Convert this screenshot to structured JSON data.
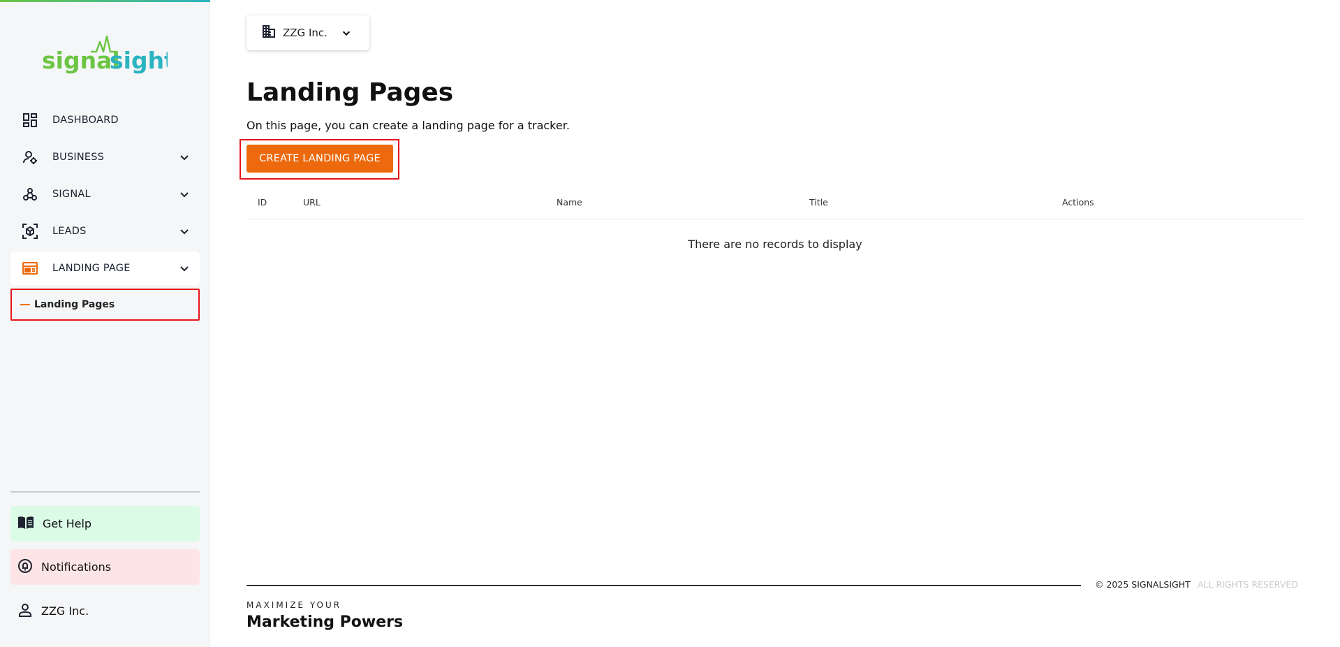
{
  "brand": {
    "logo_text_part1": "signal",
    "logo_text_part2": "sight",
    "colors": {
      "green": "#6cc644",
      "teal": "#2bb3c0",
      "accent_orange": "#ec6a0d",
      "highlight_red": "#e4161b"
    }
  },
  "sidebar": {
    "items": [
      {
        "label": "DASHBOARD",
        "icon": "dashboard-icon"
      },
      {
        "label": "BUSINESS",
        "icon": "business-user-icon"
      },
      {
        "label": "SIGNAL",
        "icon": "webhook-icon"
      },
      {
        "label": "LEADS",
        "icon": "leads-cube-icon"
      },
      {
        "label": "LANDING PAGE",
        "icon": "landing-page-icon"
      }
    ],
    "sub_items": [
      {
        "label": "Landing Pages"
      }
    ],
    "bottom": {
      "get_help": "Get Help",
      "notifications": "Notifications",
      "account": "ZZG Inc."
    }
  },
  "main": {
    "org_select": {
      "value": "ZZG Inc."
    },
    "title": "Landing Pages",
    "description": "On this page, you can create a landing page for a tracker.",
    "create_button": "CREATE LANDING PAGE",
    "table": {
      "columns": [
        "ID",
        "URL",
        "Name",
        "Title",
        "Actions"
      ],
      "rows": [],
      "empty_message": "There are no records to display"
    }
  },
  "footer": {
    "copyright": "© 2025 SIGNALSIGHT",
    "rights": "ALL RIGHTS RESERVED",
    "tagline_small": "MAXIMIZE YOUR",
    "tagline_big": "Marketing Powers"
  }
}
